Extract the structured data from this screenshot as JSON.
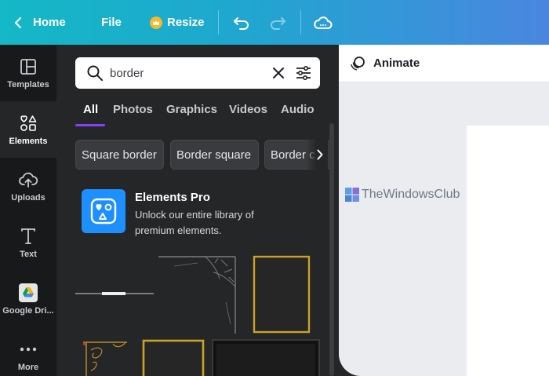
{
  "topbar": {
    "home_label": "Home",
    "file_label": "File",
    "resize_label": "Resize"
  },
  "rail": {
    "items": [
      {
        "label": "Templates",
        "icon": "templates-icon"
      },
      {
        "label": "Elements",
        "icon": "elements-icon",
        "active": true
      },
      {
        "label": "Uploads",
        "icon": "upload-cloud-icon"
      },
      {
        "label": "Text",
        "icon": "text-icon"
      },
      {
        "label": "Google Dri...",
        "icon": "google-drive-icon"
      },
      {
        "label": "More",
        "icon": "more-dots-icon"
      }
    ]
  },
  "search": {
    "value": "border"
  },
  "tabs": [
    "All",
    "Photos",
    "Graphics",
    "Videos",
    "Audio"
  ],
  "chips": [
    "Square border",
    "Border square",
    "Border c"
  ],
  "promo": {
    "title": "Elements Pro",
    "description": "Unlock our entire library of premium elements."
  },
  "editor": {
    "animate_label": "Animate"
  },
  "watermark": {
    "text": "TheWindowsClub"
  },
  "colors": {
    "accent": "#8b3dff",
    "panel_bg": "#252627",
    "rail_bg": "#18191b",
    "promo_blue": "#1e8fff",
    "gold": "#c9a227"
  }
}
